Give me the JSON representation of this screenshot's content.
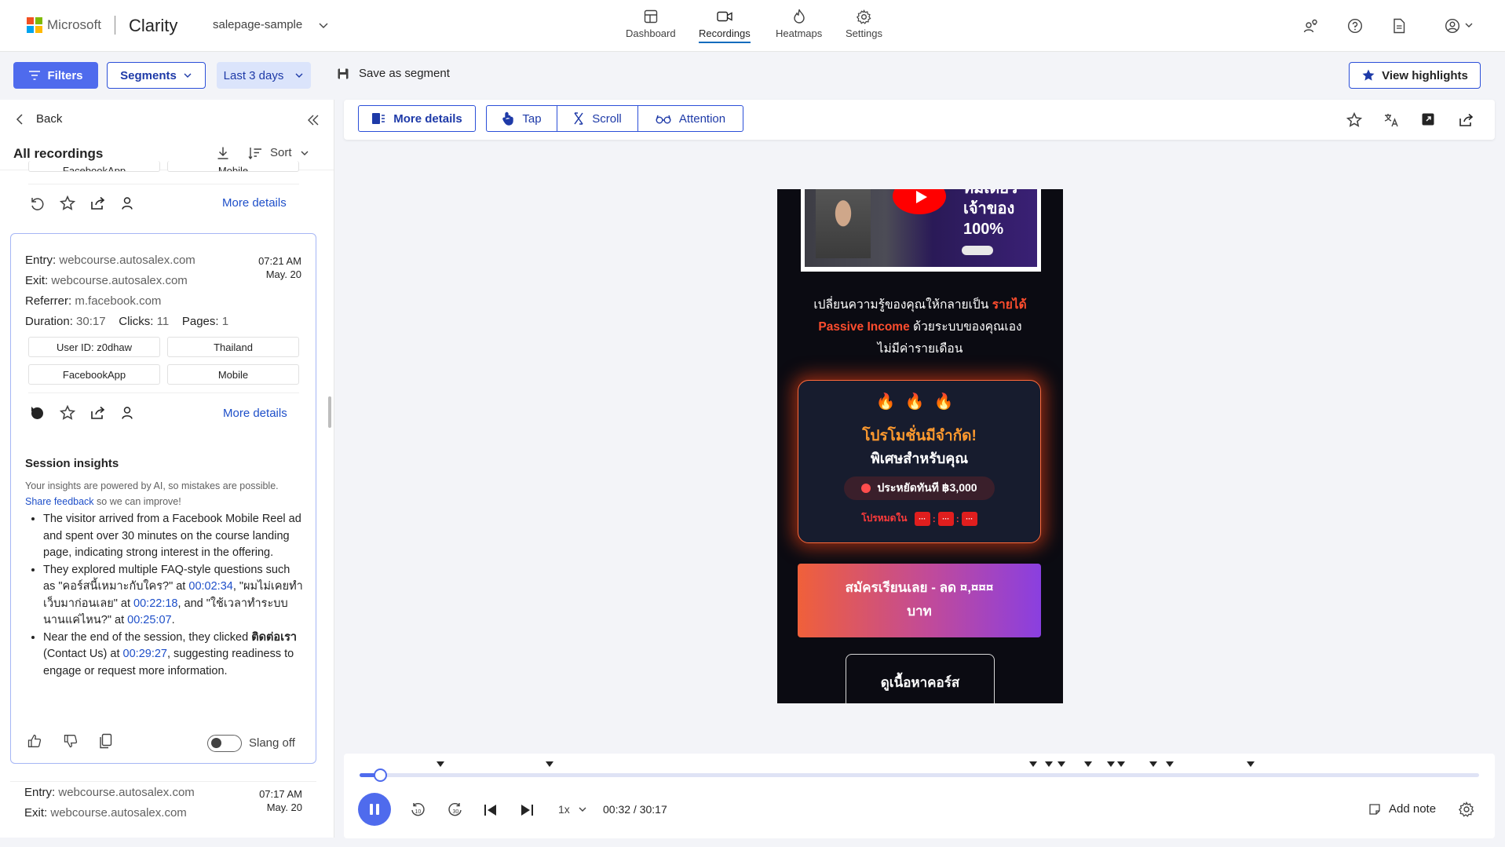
{
  "brand": {
    "company": "Microsoft",
    "product": "Clarity",
    "project": "salepage-sample",
    "logo_colors": [
      "#f25022",
      "#7fba00",
      "#00a4ef",
      "#ffb900"
    ]
  },
  "nav": [
    {
      "label": "Dashboard",
      "icon": "dashboard-icon",
      "active": false
    },
    {
      "label": "Recordings",
      "icon": "recordings-icon",
      "active": true
    },
    {
      "label": "Heatmaps",
      "icon": "heatmaps-icon",
      "active": false
    },
    {
      "label": "Settings",
      "icon": "settings-icon",
      "active": false
    }
  ],
  "toolbar": {
    "filters": "Filters",
    "segments": "Segments",
    "date_range": "Last 3 days",
    "save_segment": "Save as segment",
    "view_highlights": "View highlights"
  },
  "panel": {
    "back": "Back",
    "title": "All recordings",
    "sort": "Sort",
    "prev_card": {
      "pill_left": "FacebookApp",
      "pill_right": "Mobile",
      "more_details": "More details"
    },
    "card": {
      "entry_label": "Entry:",
      "entry": "webcourse.autosalex.com",
      "exit_label": "Exit:",
      "exit": "webcourse.autosalex.com",
      "referrer_label": "Referrer:",
      "referrer": "m.facebook.com",
      "duration_label": "Duration:",
      "duration": "30:17",
      "clicks_label": "Clicks:",
      "clicks": "11",
      "pages_label": "Pages:",
      "pages": "1",
      "time": "07:21 AM",
      "date": "May. 20",
      "user_id": "User ID: z0dhaw",
      "country": "Thailand",
      "app": "FacebookApp",
      "device": "Mobile",
      "more_details": "More details",
      "insights_title": "Session insights",
      "insights_note": "Your insights are powered by AI, so mistakes are possible.",
      "share_feedback": "Share feedback",
      "insights_note_tail": " so we can improve!",
      "b1": "The visitor arrived from a Facebook Mobile Reel ad and spent over 30 minutes on the course landing page, indicating strong interest in the offering.",
      "b2_pre": "They explored multiple FAQ-style questions such as \"คอร์สนี้เหมาะกับใคร?\" at ",
      "b2_t1": "00:02:34",
      "b2_mid1": ", \"ผมไม่เคยทำเว็บมาก่อนเลย\" at ",
      "b2_t2": "00:22:18",
      "b2_mid2": ", and \"ใช้เวลาทำระบบนานแค่ไหน?\" at ",
      "b2_t3": "00:25:07",
      "b2_end": ".",
      "b3_pre": "Near the end of the session, they clicked ",
      "b3_bold": "ติดต่อเรา",
      "b3_mid": " (Contact Us) at ",
      "b3_t": "00:29:27",
      "b3_end": ", suggesting readiness to engage or request more information.",
      "slang": "Slang off"
    },
    "next_card": {
      "entry_label": "Entry:",
      "entry": "webcourse.autosalex.com",
      "exit_label": "Exit:",
      "exit": "webcourse.autosalex.com",
      "time": "07:17 AM",
      "date": "May. 20"
    }
  },
  "main_toolbar": {
    "more_details": "More details",
    "tap": "Tap",
    "scroll": "Scroll",
    "attention": "Attention"
  },
  "phone": {
    "video_text_1": "ทีมเดียว",
    "video_text_2": "เจ้าของ",
    "video_text_3": "100%",
    "headline_1": "เปลี่ยนความรู้ของคุณให้กลายเป็น ",
    "headline_hl1": "รายได้",
    "headline_hl2": "Passive Income",
    "headline_2": " ด้วยระบบของคุณเอง",
    "headline_3": "ไม่มีค่ารายเดือน",
    "fires": "🔥🔥🔥",
    "promo_1": "โปรโมชั่นมีจำกัด!",
    "promo_2": "พิเศษสำหรับคุณ",
    "save": "ประหยัดทันที ฿3,000",
    "ends_in": "โปรหมดใน",
    "cta": "สมัครเรียนเลย - ลด ¤,¤¤¤ บาท",
    "outline": "ดูเนื้อหาคอร์ส"
  },
  "player": {
    "speed": "1x",
    "time": "00:32 / 30:17",
    "add_note": "Add note",
    "progress": 0.018,
    "markers": [
      0.072,
      0.17,
      0.602,
      0.616,
      0.627,
      0.651,
      0.671,
      0.68,
      0.709,
      0.724,
      0.796
    ]
  }
}
